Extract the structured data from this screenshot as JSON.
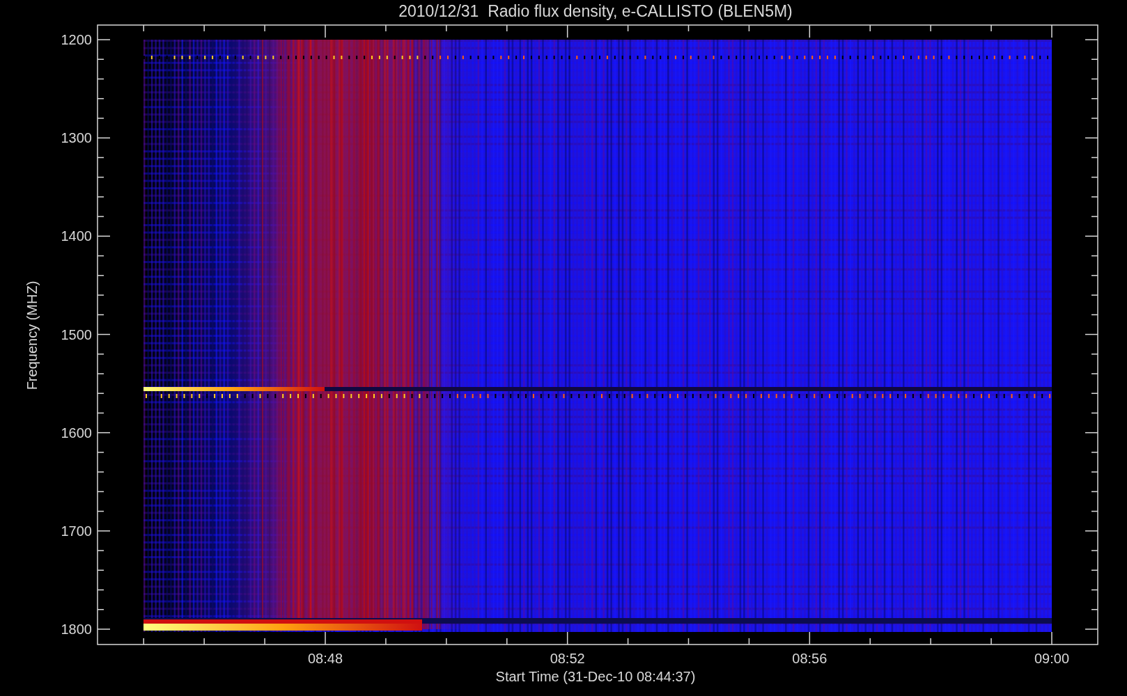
{
  "title": "2010/12/31  Radio flux density, e-CALLISTO (BLEN5M)",
  "y_axis": {
    "label": "Frequency (MHZ)",
    "ticks": [
      "1200",
      "1300",
      "1400",
      "1500",
      "1600",
      "1700",
      "1800"
    ]
  },
  "x_axis": {
    "label": "Start Time (31-Dec-10 08:44:37)",
    "ticks": [
      "08:48",
      "08:52",
      "08:56",
      "09:00"
    ]
  }
}
